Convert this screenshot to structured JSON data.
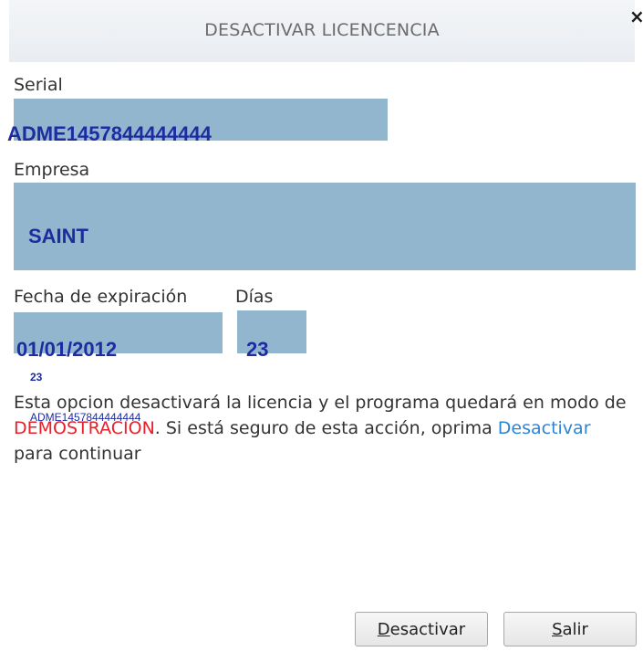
{
  "dialog": {
    "title": "DESACTIVAR LICENCENCIA",
    "close_glyph": "×"
  },
  "serial": {
    "label": "Serial",
    "value": "ADME1457844444444"
  },
  "empresa": {
    "label": "Empresa",
    "value": "SAINT"
  },
  "fecha": {
    "label": "Fecha de expiración",
    "value": "01/01/2012"
  },
  "dias": {
    "label": "Días",
    "value": "23"
  },
  "overlay": {
    "small_days": "23",
    "small_serial": "ADME1457844444444"
  },
  "message": {
    "part1": "Esta opcion desactivará la licencia y el programa quedará en modo de ",
    "highlight_red": "DEMOSTRACION",
    "part2": ". Si está seguro de esta acción, oprima ",
    "highlight_blue": "Desactivar",
    "part3": " para continuar"
  },
  "buttons": {
    "deactivate_first": "D",
    "deactivate_rest": "esactivar",
    "exit_first": "S",
    "exit_rest": "alir"
  },
  "colors": {
    "field_bg": "#92b6ce",
    "value_text": "#1f2ba0",
    "highlight_red": "#e8202a",
    "highlight_blue": "#2d84d6"
  }
}
